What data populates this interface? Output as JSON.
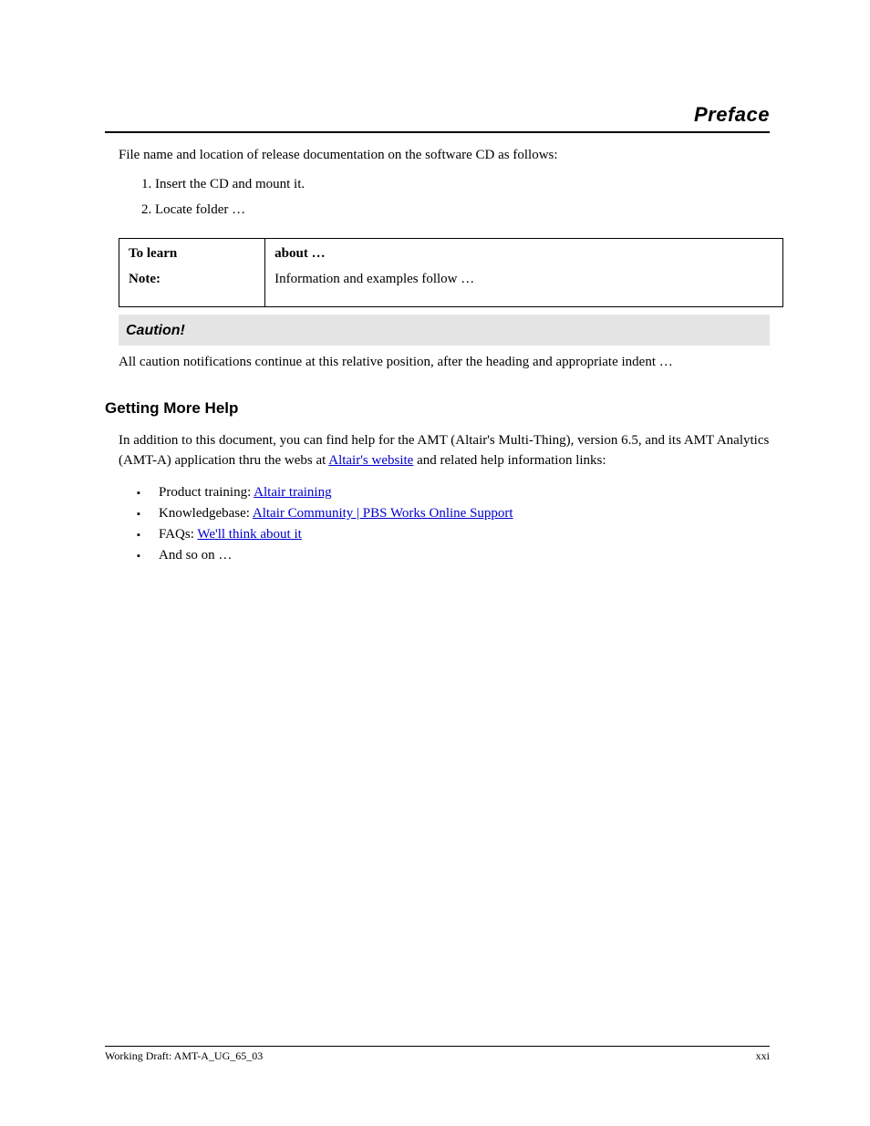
{
  "header": {
    "title": "Preface"
  },
  "procedure": {
    "intro": "File name and location of release documentation on the software CD as follows:",
    "steps": [
      "Insert the CD and mount it.",
      "Locate folder …"
    ]
  },
  "table": {
    "col1_header": "To learn",
    "col2_header": "about …",
    "row": {
      "label": "Note:",
      "text": "Information and examples follow …"
    }
  },
  "caution": {
    "label": "Caution!",
    "text": "All caution notifications continue at this relative position, after the heading and appropriate indent …"
  },
  "more_help": {
    "heading": "Getting More Help",
    "para1_a": "In addition to this document, you can find help for the AMT (Altair's Multi-Thing), version 6.5, and its AMT Analytics (AMT-A) application thru the webs at ",
    "para1_link1": "Altair's website",
    "para1_b": " and related help information links:",
    "bullets": [
      {
        "pre": "Product training: ",
        "link": "Altair training"
      },
      {
        "pre": "Knowledgebase: ",
        "link": "Altair Community | PBS Works Online Support"
      },
      {
        "pre": "FAQs: ",
        "link": "We'll think about it"
      },
      {
        "pre": "And so on …",
        "link": ""
      }
    ]
  },
  "footer": {
    "left": "Working Draft: AMT-A_UG_65_03",
    "right": "xxi"
  }
}
